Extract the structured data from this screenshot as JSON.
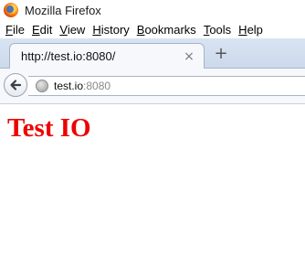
{
  "window": {
    "title": "Mozilla Firefox"
  },
  "menu": [
    {
      "mnemonic": "F",
      "rest": "ile"
    },
    {
      "mnemonic": "E",
      "rest": "dit"
    },
    {
      "mnemonic": "V",
      "rest": "iew"
    },
    {
      "mnemonic": "H",
      "rest": "istory"
    },
    {
      "mnemonic": "B",
      "rest": "ookmarks"
    },
    {
      "mnemonic": "T",
      "rest": "ools"
    },
    {
      "mnemonic": "H",
      "rest": "elp"
    }
  ],
  "tab": {
    "label": "http://test.io:8080/",
    "close_glyph": "×"
  },
  "newtab": {
    "glyph": "+"
  },
  "urlbar": {
    "host": "test.io",
    "port": ":8080"
  },
  "page": {
    "heading": "Test IO"
  },
  "colors": {
    "heading": "#ee0000",
    "tabstrip": "#d9e4f2",
    "accent": "#2d64c8"
  },
  "icons": [
    "firefox-logo-icon",
    "close-icon",
    "plus-icon",
    "back-arrow-icon",
    "globe-icon"
  ]
}
